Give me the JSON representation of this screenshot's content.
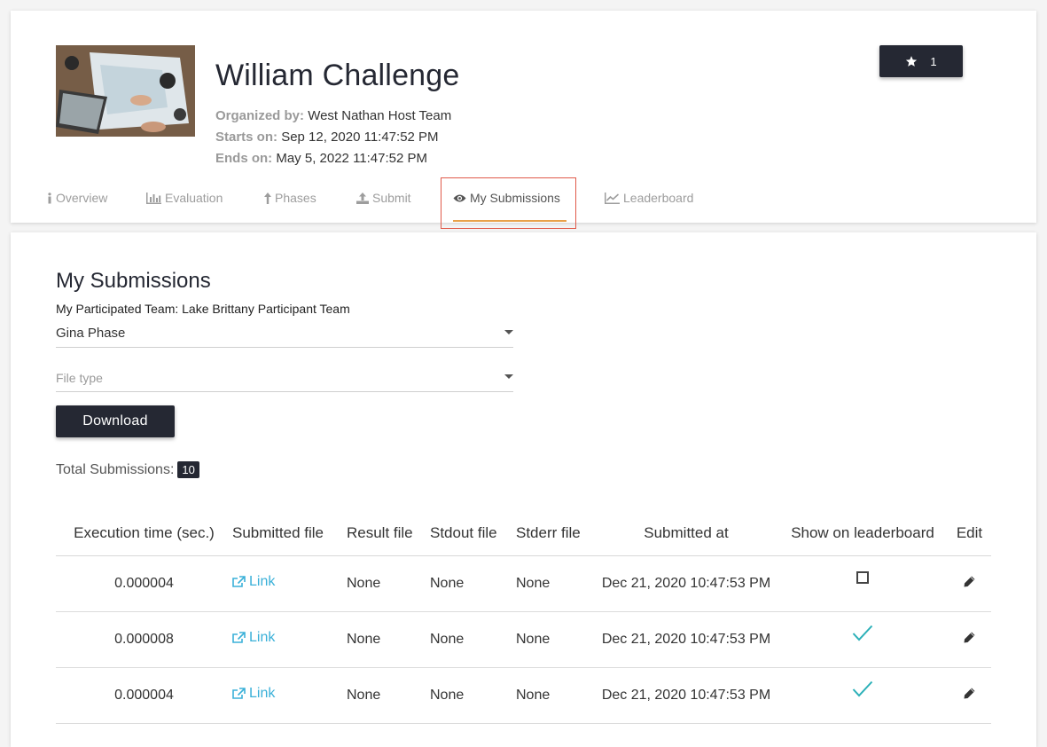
{
  "challenge": {
    "title": "William Challenge",
    "organized_label": "Organized by:",
    "organized_value": "West Nathan Host Team",
    "starts_label": "Starts on:",
    "starts_value": "Sep 12, 2020 11:47:52 PM",
    "ends_label": "Ends on:",
    "ends_value": "May 5, 2022 11:47:52 PM",
    "star_count": "1"
  },
  "tabs": [
    {
      "label": "Overview",
      "icon": "info-icon"
    },
    {
      "label": "Evaluation",
      "icon": "bar-chart-icon"
    },
    {
      "label": "Phases",
      "icon": "arrow-up-icon"
    },
    {
      "label": "Submit",
      "icon": "upload-icon"
    },
    {
      "label": "My Submissions",
      "icon": "eye-icon",
      "active": true
    },
    {
      "label": "Leaderboard",
      "icon": "line-chart-icon"
    }
  ],
  "submissions": {
    "title": "My Submissions",
    "team_line": "My Participated Team: Lake Brittany Participant Team",
    "phase_value": "Gina Phase",
    "file_type_placeholder": "File type",
    "download_label": "Download",
    "total_label": "Total Submissions:",
    "total_count": "10",
    "columns": [
      "Execution time (sec.)",
      "Submitted file",
      "Result file",
      "Stdout file",
      "Stderr file",
      "Submitted at",
      "Show on leaderboard",
      "Edit"
    ],
    "rows": [
      {
        "exec": "0.000004",
        "file": "Link",
        "result": "None",
        "stdout": "None",
        "stderr": "None",
        "at": "Dec 21, 2020 10:47:53 PM",
        "show": false
      },
      {
        "exec": "0.000008",
        "file": "Link",
        "result": "None",
        "stdout": "None",
        "stderr": "None",
        "at": "Dec 21, 2020 10:47:53 PM",
        "show": true
      },
      {
        "exec": "0.000004",
        "file": "Link",
        "result": "None",
        "stdout": "None",
        "stderr": "None",
        "at": "Dec 21, 2020 10:47:53 PM",
        "show": true
      }
    ]
  },
  "colors": {
    "primary": "#252833",
    "accent": "#e8a14a",
    "link": "#3ab0d8",
    "check": "#2bb0b8",
    "highlight": "#e05a4a"
  }
}
